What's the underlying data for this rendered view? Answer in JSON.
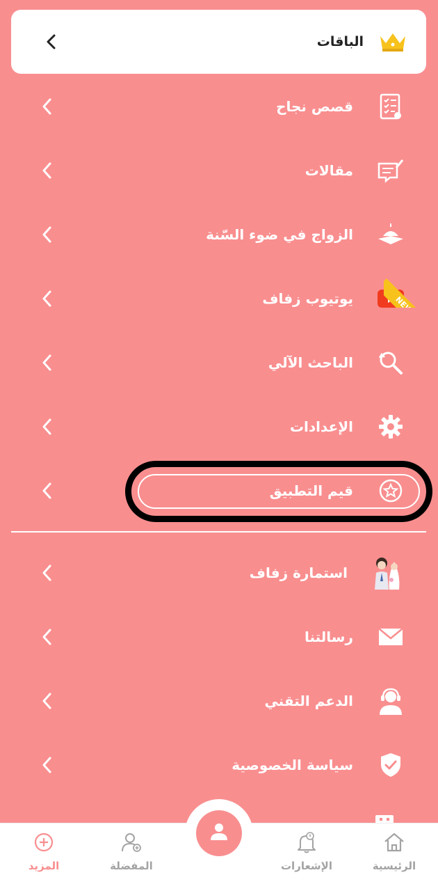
{
  "packages": {
    "label": "الباقات",
    "icon": "crown-icon"
  },
  "menu": [
    {
      "label": "قصص نجاح",
      "icon": "success-checklist-icon"
    },
    {
      "label": "مقالات",
      "icon": "articles-icon"
    },
    {
      "label": "الزواج في ضوء السّنة",
      "icon": "mosque-book-icon"
    },
    {
      "label": "يوتيوب زفاف",
      "icon": "youtube-icon",
      "badge": "NEW"
    },
    {
      "label": "الباحث الآلي",
      "icon": "search-refresh-icon"
    },
    {
      "label": "الإعدادات",
      "icon": "gear-icon"
    },
    {
      "label": "قيم التطبيق",
      "icon": "star-circle-icon"
    },
    {
      "label": "استمارة زفاف",
      "icon": "wedding-couple-icon"
    },
    {
      "label": "رسالتنا",
      "icon": "envelope-icon"
    },
    {
      "label": "الدعم التقني",
      "icon": "support-headset-icon"
    },
    {
      "label": "سياسة الخصوصية",
      "icon": "shield-check-icon"
    }
  ],
  "bottom_nav": [
    {
      "label": "الرئيسية",
      "icon": "home-icon",
      "active": false
    },
    {
      "label": "الإشعارات",
      "icon": "bell-icon",
      "active": false
    },
    {
      "label": "المفضلة",
      "icon": "favorite-user-icon",
      "active": false
    },
    {
      "label": "المزيد",
      "icon": "plus-circle-icon",
      "active": true
    }
  ],
  "colors": {
    "background": "#f98e8f",
    "card": "#ffffff",
    "accent": "#f98e8f",
    "inactive": "#a3a3a3",
    "ribbon": "#f7c21c",
    "youtube": "#f03b1f"
  }
}
